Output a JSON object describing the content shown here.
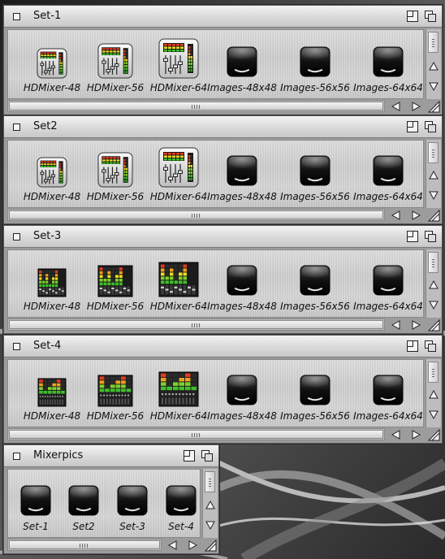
{
  "windows": [
    {
      "id": "set-1",
      "title": "Set-1",
      "icons": [
        {
          "label": "HDMixer-48",
          "icon": "mixer-boxed-icon"
        },
        {
          "label": "HDMixer-56",
          "icon": "mixer-boxed-icon"
        },
        {
          "label": "HDMixer-64",
          "icon": "mixer-boxed-icon"
        },
        {
          "label": "Images-48x48",
          "icon": "black-drive-icon"
        },
        {
          "label": "Images-56x56",
          "icon": "black-drive-icon"
        },
        {
          "label": "Images-64x64",
          "icon": "black-drive-icon"
        }
      ]
    },
    {
      "id": "set2",
      "title": "Set2",
      "icons": [
        {
          "label": "HDMixer-48",
          "icon": "mixer-boxed-icon"
        },
        {
          "label": "HDMixer-56",
          "icon": "mixer-boxed-icon"
        },
        {
          "label": "HDMixer-64",
          "icon": "mixer-boxed-icon"
        },
        {
          "label": "Images-48x48",
          "icon": "black-drive-icon"
        },
        {
          "label": "Images-56x56",
          "icon": "black-drive-icon"
        },
        {
          "label": "Images-64x64",
          "icon": "black-drive-icon"
        }
      ]
    },
    {
      "id": "set-3",
      "title": "Set-3",
      "icons": [
        {
          "label": "HDMixer-48",
          "icon": "mixer-console-icon"
        },
        {
          "label": "HDMixer-56",
          "icon": "mixer-console-icon"
        },
        {
          "label": "HDMixer-64",
          "icon": "mixer-console-icon"
        },
        {
          "label": "Images-48x48",
          "icon": "black-drive-icon"
        },
        {
          "label": "Images-56x56",
          "icon": "black-drive-icon"
        },
        {
          "label": "Images-64x64",
          "icon": "black-drive-icon"
        }
      ]
    },
    {
      "id": "set-4",
      "title": "Set-4",
      "icons": [
        {
          "label": "HDMixer-48",
          "icon": "mixer-meter-icon"
        },
        {
          "label": "HDMixer-56",
          "icon": "mixer-meter-icon"
        },
        {
          "label": "HDMixer-64",
          "icon": "mixer-meter-icon"
        },
        {
          "label": "Images-48x48",
          "icon": "black-drive-icon"
        },
        {
          "label": "Images-56x56",
          "icon": "black-drive-icon"
        },
        {
          "label": "Images-64x64",
          "icon": "black-drive-icon"
        }
      ]
    },
    {
      "id": "mixerpics",
      "title": "Mixerpics",
      "icons": [
        {
          "label": "Set-1",
          "icon": "black-drive-icon"
        },
        {
          "label": "Set2",
          "icon": "black-drive-icon"
        },
        {
          "label": "Set-3",
          "icon": "black-drive-icon"
        },
        {
          "label": "Set-4",
          "icon": "black-drive-icon"
        }
      ]
    }
  ]
}
